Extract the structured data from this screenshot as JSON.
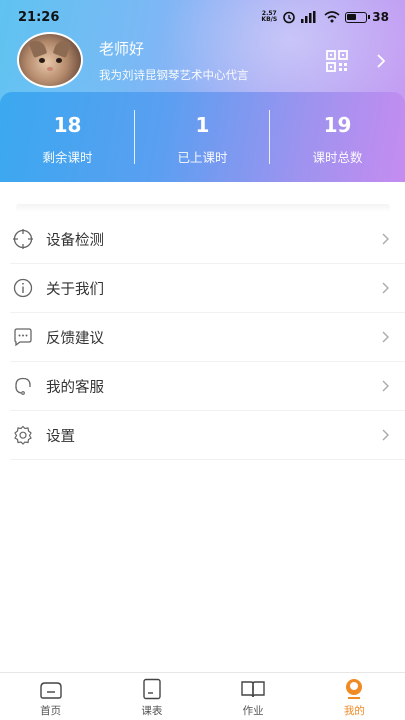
{
  "status_bar": {
    "time": "21:26",
    "net_speed_top": "2.57",
    "net_speed_bottom": "KB/S",
    "battery": "38"
  },
  "profile": {
    "name": "老师好",
    "subtitle": "我为刘诗昆钢琴艺术中心代言"
  },
  "stats": [
    {
      "value": "18",
      "label": "剩余课时"
    },
    {
      "value": "1",
      "label": "已上课时"
    },
    {
      "value": "19",
      "label": "课时总数"
    }
  ],
  "menu": [
    {
      "label": "设备检测",
      "icon": "target-icon"
    },
    {
      "label": "关于我们",
      "icon": "info-icon"
    },
    {
      "label": "反馈建议",
      "icon": "chat-icon"
    },
    {
      "label": "我的客服",
      "icon": "headset-icon"
    },
    {
      "label": "设置",
      "icon": "gear-icon"
    }
  ],
  "tabs": [
    {
      "label": "首页",
      "icon": "home-icon",
      "active": false
    },
    {
      "label": "课表",
      "icon": "schedule-icon",
      "active": false
    },
    {
      "label": "作业",
      "icon": "book-icon",
      "active": false
    },
    {
      "label": "我的",
      "icon": "profile-icon",
      "active": true
    }
  ],
  "colors": {
    "accent": "#f08a24",
    "header_start": "#5fc3f0",
    "header_end": "#c89cf3"
  }
}
